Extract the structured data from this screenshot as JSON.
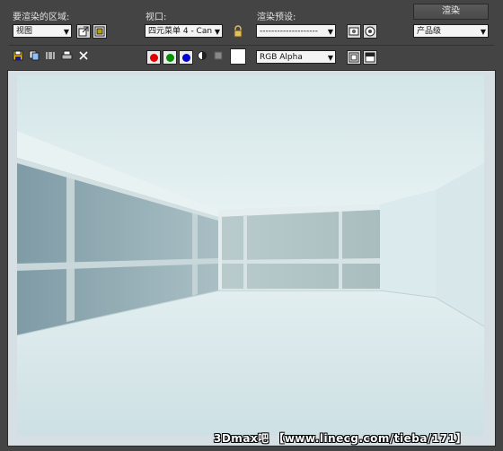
{
  "toolbar": {
    "area_label": "要渲染的区域:",
    "area_value": "视图",
    "viewport_label": "视口:",
    "viewport_value": "四元菜单 4 - Can",
    "preset_label": "渲染预设:",
    "preset_value": "--------------------",
    "render_button": "渲染",
    "quality_value": "产品级"
  },
  "toolbar2": {
    "channel_value": "RGB Alpha"
  },
  "colors": {
    "red_channel": "#e00000",
    "green_channel": "#009000",
    "blue_channel": "#0000d0"
  },
  "watermark": "3Dmax吧 【www.linecg.com/tieba/171】"
}
